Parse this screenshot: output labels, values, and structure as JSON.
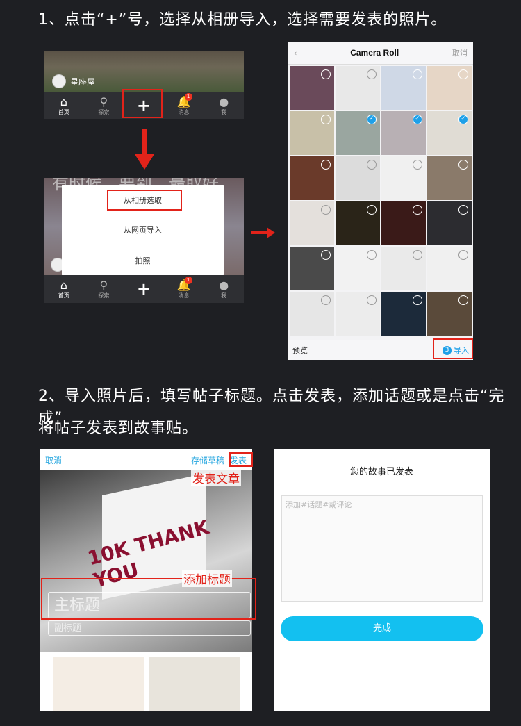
{
  "step1": {
    "title": "1、点击“+”号，选择从相册导入，选择需要发表的照片。"
  },
  "phone_top": {
    "user": "星座屋",
    "tabs": [
      {
        "icon": "home-icon",
        "label": "首页"
      },
      {
        "icon": "search-icon",
        "label": "探索"
      },
      {
        "icon": "plus-icon",
        "label": ""
      },
      {
        "icon": "bell-icon",
        "label": "消息",
        "badge": "1"
      },
      {
        "icon": "person-icon",
        "label": "我"
      }
    ]
  },
  "phone_menu": {
    "bg_text": "有时候，要到，最取好",
    "options": [
      "从相册选取",
      "从网页导入",
      "拍照"
    ],
    "tabs": [
      {
        "icon": "home-icon",
        "label": "首页"
      },
      {
        "icon": "search-icon",
        "label": "探索"
      },
      {
        "icon": "plus-icon",
        "label": ""
      },
      {
        "icon": "bell-icon",
        "label": "消息",
        "badge": "1"
      },
      {
        "icon": "person-icon",
        "label": "我"
      }
    ]
  },
  "camera_roll": {
    "title": "Camera Roll",
    "back": "‹",
    "cancel": "取消",
    "preview": "预览",
    "import_count": "3",
    "import_label": "导入"
  },
  "step2": {
    "title_line1": "2、导入照片后，填写帖子标题。点击发表，添加话题或是点击“完成”",
    "title_line2": "将帖子发表到故事贴。"
  },
  "editor": {
    "cancel": "取消",
    "save_draft": "存储草稿",
    "publish": "发表",
    "callout_publish": "发表文章",
    "callout_title": "添加标题",
    "main_title_placeholder": "主标题",
    "sub_title_placeholder": "副标题",
    "hero_text": "10K THANK YOU"
  },
  "published": {
    "title": "您的故事已发表",
    "comment_placeholder": "添加#话题#或评论",
    "done_button": "完成"
  },
  "colors": {
    "accent_red": "#e2231a",
    "ios_blue": "#1ea0e8",
    "done_blue": "#13c0f0",
    "page_bg": "#1e1f23"
  }
}
